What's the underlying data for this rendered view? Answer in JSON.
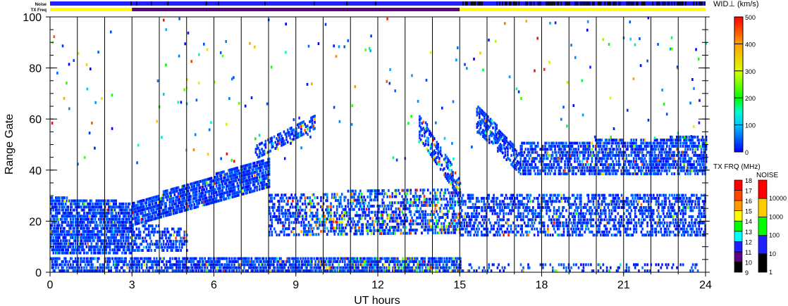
{
  "chart_data": {
    "type": "heatmap",
    "xlabel": "UT hours",
    "ylabel": "Range Gate",
    "xlim": [
      0,
      24
    ],
    "ylim": [
      0,
      100
    ],
    "xticks": [
      "0",
      "3",
      "6",
      "9",
      "12",
      "15",
      "18",
      "21",
      "24"
    ],
    "yticks": [
      "0",
      "20",
      "40",
      "60",
      "80",
      "100"
    ],
    "top_bars": {
      "noise_label": "Noise",
      "txfreq_label": "TX Freq",
      "txfreq_segments": [
        {
          "from": 0,
          "to": 3,
          "color": "#ffff00"
        },
        {
          "from": 3,
          "to": 15,
          "color": "#5a0080"
        },
        {
          "from": 15,
          "to": 24,
          "color": "#ffff00"
        }
      ]
    },
    "colorbar_width": {
      "title": "WID⊥ (km/s)",
      "ticks": [
        "0",
        "100",
        "200",
        "300",
        "400",
        "500"
      ],
      "range": [
        0,
        500
      ]
    },
    "colorbar_txfreq": {
      "title": "TX FRQ (MHz)",
      "ticks": [
        "9",
        "10",
        "11",
        "12",
        "13",
        "14",
        "15",
        "16",
        "17",
        "18"
      ],
      "colors": [
        "#000000",
        "#5a0080",
        "#2020ff",
        "#00ffff",
        "#00ff00",
        "#ffff00",
        "#ff9900",
        "#ff4400",
        "#ff0000"
      ]
    },
    "colorbar_noise": {
      "title": "NOISE",
      "ticks": [
        "1",
        "10",
        "100",
        "1000",
        "10000"
      ],
      "colors": [
        "#000000",
        "#2020ff",
        "#00ff00",
        "#ffcc00",
        "#ff0000"
      ]
    },
    "bands": [
      {
        "t0": 0,
        "t1": 3,
        "g0a": 7,
        "g1a": 29,
        "g0b": 7,
        "g1b": 27,
        "p": 0.75
      },
      {
        "t0": 0,
        "t1": 4.6,
        "g0a": 0,
        "g1a": 6,
        "g0b": 0,
        "g1b": 5,
        "p": 0.6
      },
      {
        "t0": 3,
        "t1": 8,
        "g0a": 18,
        "g1a": 27,
        "g0b": 33,
        "g1b": 45,
        "p": 0.8
      },
      {
        "t0": 3,
        "t1": 5,
        "g0a": 8,
        "g1a": 20,
        "g0b": 8,
        "g1b": 16,
        "p": 0.5
      },
      {
        "t0": 4.6,
        "t1": 15,
        "g0a": 0,
        "g1a": 5,
        "g0b": 0,
        "g1b": 5,
        "p": 0.75
      },
      {
        "t0": 7.5,
        "t1": 9.7,
        "g0a": 44,
        "g1a": 50,
        "g0b": 56,
        "g1b": 62,
        "p": 0.5
      },
      {
        "t0": 8,
        "t1": 15,
        "g0a": 14,
        "g1a": 30,
        "g0b": 15,
        "g1b": 33,
        "p": 0.45
      },
      {
        "t0": 13.5,
        "t1": 15,
        "g0a": 52,
        "g1a": 62,
        "g0b": 28,
        "g1b": 36,
        "p": 0.55
      },
      {
        "t0": 15.6,
        "t1": 17.2,
        "g0a": 55,
        "g1a": 66,
        "g0b": 38,
        "g1b": 46,
        "p": 0.6
      },
      {
        "t0": 17.2,
        "t1": 24,
        "g0a": 38,
        "g1a": 50,
        "g0b": 38,
        "g1b": 53,
        "p": 0.6
      },
      {
        "t0": 15,
        "t1": 24,
        "g0a": 14,
        "g1a": 30,
        "g0b": 14,
        "g1b": 30,
        "p": 0.45
      },
      {
        "t0": 15,
        "t1": 24,
        "g0a": 0,
        "g1a": 3,
        "g0b": 0,
        "g1b": 3,
        "p": 0.2
      }
    ]
  }
}
